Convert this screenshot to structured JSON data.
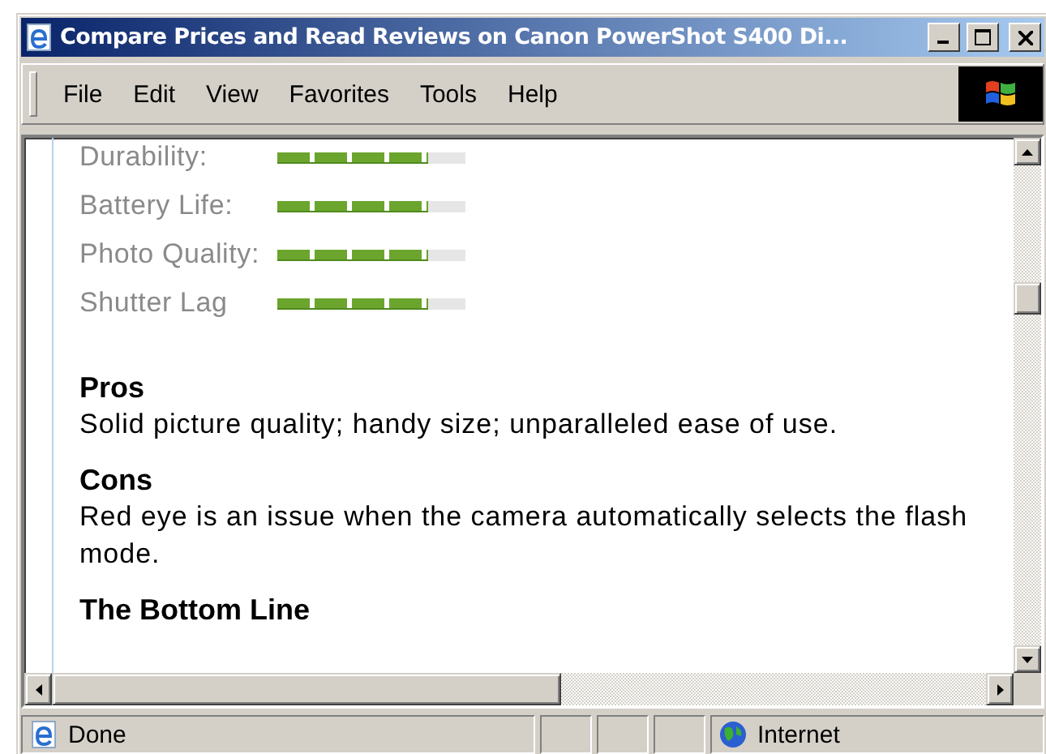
{
  "window": {
    "title": "Compare Prices and Read Reviews on Canon PowerShot S400 Di..."
  },
  "menu": [
    "File",
    "Edit",
    "View",
    "Favorites",
    "Tools",
    "Help"
  ],
  "ratings": [
    {
      "label": "Durability:",
      "level": 0.8
    },
    {
      "label": "Battery Life:",
      "level": 0.8
    },
    {
      "label": "Photo Quality:",
      "level": 0.8
    },
    {
      "label": "Shutter Lag",
      "level": 0.8
    }
  ],
  "sections": [
    {
      "heading": "Pros",
      "text": "Solid picture quality; handy size; unparalleled ease of use."
    },
    {
      "heading": "Cons",
      "text": "Red eye is an issue when the camera automatically selects the flash mode."
    },
    {
      "heading": "The Bottom Line"
    }
  ],
  "status_bar": {
    "status": "Done",
    "zone": "Internet"
  }
}
